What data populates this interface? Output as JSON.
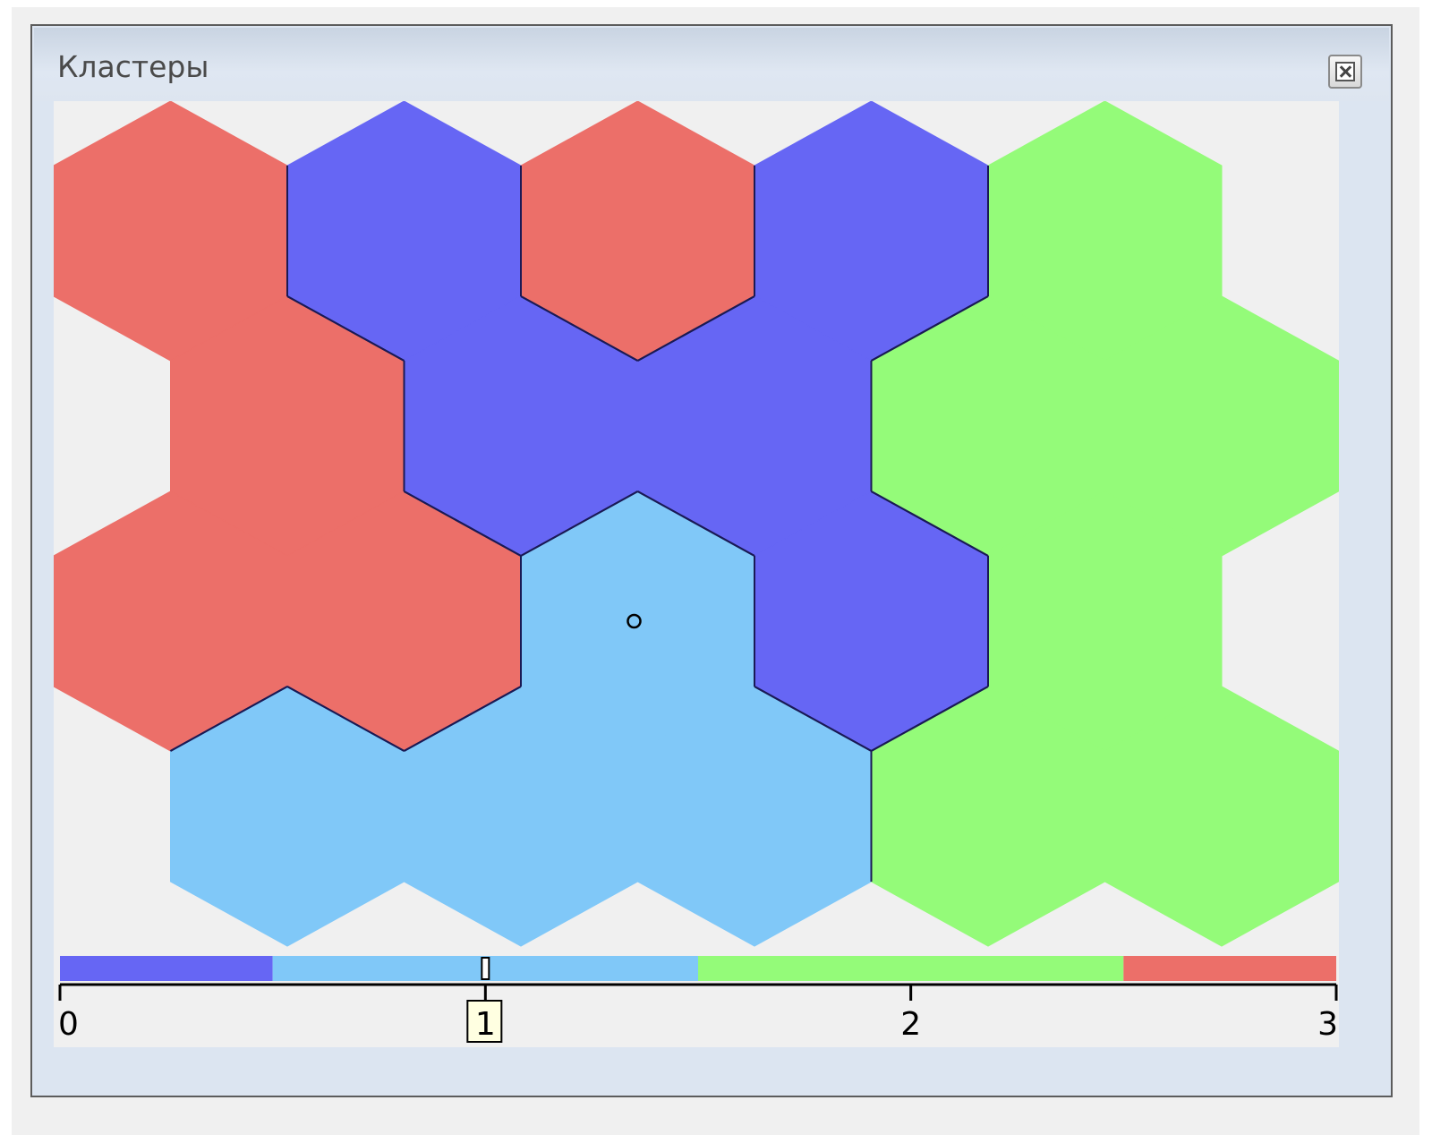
{
  "window": {
    "title": "Кластеры"
  },
  "map": {
    "cells": [
      {
        "row": 0,
        "col": 0,
        "cluster": 3
      },
      {
        "row": 0,
        "col": 1,
        "cluster": 0
      },
      {
        "row": 0,
        "col": 2,
        "cluster": 3
      },
      {
        "row": 0,
        "col": 3,
        "cluster": 0
      },
      {
        "row": 0,
        "col": 4,
        "cluster": 2
      },
      {
        "row": 1,
        "col": 0,
        "cluster": 3
      },
      {
        "row": 1,
        "col": 1,
        "cluster": 0
      },
      {
        "row": 1,
        "col": 2,
        "cluster": 0
      },
      {
        "row": 1,
        "col": 3,
        "cluster": 2
      },
      {
        "row": 1,
        "col": 4,
        "cluster": 2
      },
      {
        "row": 2,
        "col": 0,
        "cluster": 3
      },
      {
        "row": 2,
        "col": 1,
        "cluster": 3
      },
      {
        "row": 2,
        "col": 2,
        "cluster": 1
      },
      {
        "row": 2,
        "col": 3,
        "cluster": 0
      },
      {
        "row": 2,
        "col": 4,
        "cluster": 2
      },
      {
        "row": 3,
        "col": 0,
        "cluster": 1
      },
      {
        "row": 3,
        "col": 1,
        "cluster": 1
      },
      {
        "row": 3,
        "col": 2,
        "cluster": 1
      },
      {
        "row": 3,
        "col": 3,
        "cluster": 2
      },
      {
        "row": 3,
        "col": 4,
        "cluster": 2
      }
    ],
    "selected_cell": {
      "row": 2,
      "col": 2
    },
    "cluster_colors": [
      "#6666f4",
      "#80c8f8",
      "#94fb79",
      "#ec6f69"
    ]
  },
  "colorbar": {
    "ticks": [
      "0",
      "1",
      "2",
      "3"
    ],
    "selected_value": "1",
    "min": 0,
    "max": 3
  }
}
